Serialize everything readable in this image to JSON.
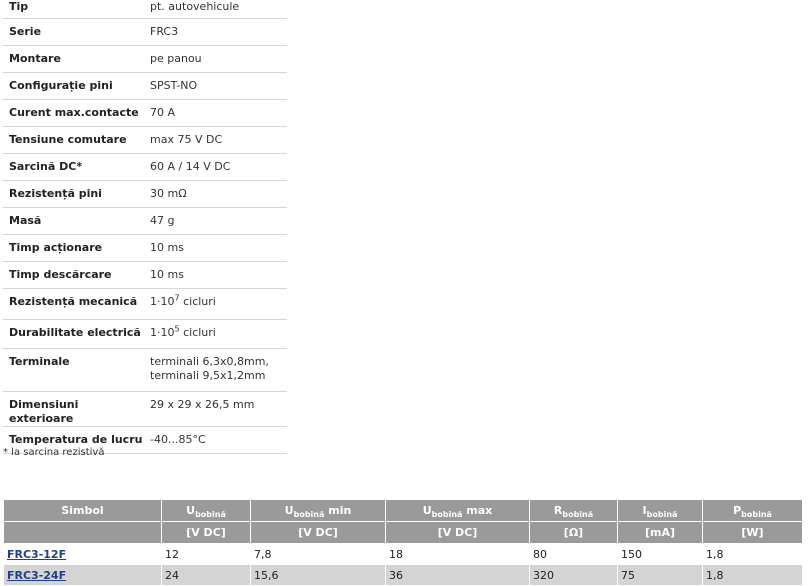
{
  "specs": [
    {
      "label": "Tip",
      "value": "pt. autovehicule"
    },
    {
      "label": "Serie",
      "value": "FRC3"
    },
    {
      "label": "Montare",
      "value": "pe panou"
    },
    {
      "label": "Configurație pini",
      "value": "SPST-NO"
    },
    {
      "label": "Curent max.contacte",
      "value": "70 A"
    },
    {
      "label": "Tensiune comutare",
      "value": "max 75 V DC"
    },
    {
      "label": "Sarcină DC*",
      "value": "60 A / 14 V DC"
    },
    {
      "label": "Rezistență pini",
      "value": "30 mΩ"
    },
    {
      "label": "Masă",
      "value": "47 g"
    },
    {
      "label": "Timp acționare",
      "value": "10 ms"
    },
    {
      "label": "Timp descărcare",
      "value": "10 ms"
    },
    {
      "label": "Rezistență mecanică",
      "value_pre": "1·10",
      "value_sup": "7",
      "value_post": " cicluri"
    },
    {
      "label": "Durabilitate electrică",
      "value_pre": "1·10",
      "value_sup": "5",
      "value_post": " cicluri"
    },
    {
      "label": "Terminale",
      "value_line1": "terminali 6,3x0,8mm,",
      "value_line2": "terminali 9,5x1,2mm"
    },
    {
      "label": "Dimensiuni exterioare",
      "value": "29 x 29 x 26,5 mm"
    },
    {
      "label": "Temperatura de lucru",
      "value": "-40...85°C"
    }
  ],
  "footnote": "* la sarcina rezistivă",
  "models": {
    "headers": [
      {
        "base": "Simbol",
        "sub": "",
        "suffix": ""
      },
      {
        "base": "U",
        "sub": "bobină",
        "suffix": ""
      },
      {
        "base": "U",
        "sub": "bobină",
        "suffix": " min"
      },
      {
        "base": "U",
        "sub": "bobină",
        "suffix": " max"
      },
      {
        "base": "R",
        "sub": "bobină",
        "suffix": ""
      },
      {
        "base": "I",
        "sub": "bobină",
        "suffix": ""
      },
      {
        "base": "P",
        "sub": "bobină",
        "suffix": ""
      }
    ],
    "units": [
      "",
      "[V DC]",
      "[V DC]",
      "[V DC]",
      "[Ω]",
      "[mA]",
      "[W]"
    ],
    "rows": [
      {
        "symbol": "FRC3-12F",
        "cells": [
          "12",
          "7,8",
          "18",
          "80",
          "150",
          "1,8"
        ]
      },
      {
        "symbol": "FRC3-24F",
        "cells": [
          "24",
          "15,6",
          "36",
          "320",
          "75",
          "1,8"
        ]
      }
    ]
  }
}
